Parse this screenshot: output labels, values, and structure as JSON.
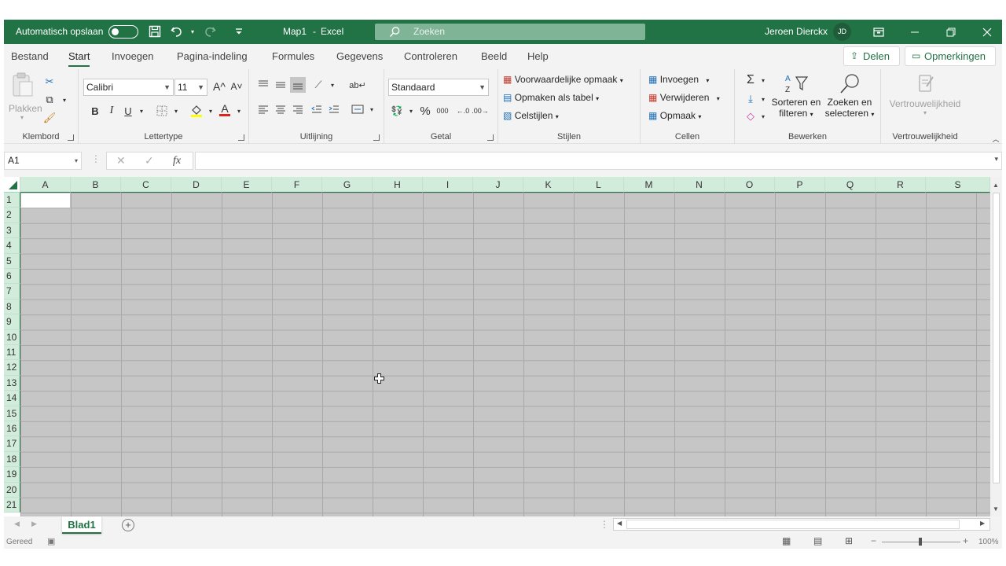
{
  "titlebar": {
    "autosave_label": "Automatisch opslaan",
    "doc_title": "Map1",
    "separator": "-",
    "app_name": "Excel",
    "search_placeholder": "Zoeken",
    "user_name": "Jeroen Dierckx",
    "user_initials": "JD",
    "accent_color": "#217346"
  },
  "tabs": [
    "Bestand",
    "Start",
    "Invoegen",
    "Pagina-indeling",
    "Formules",
    "Gegevens",
    "Controleren",
    "Beeld",
    "Help"
  ],
  "active_tab": "Start",
  "share_label": "Delen",
  "comments_label": "Opmerkingen",
  "ribbon": {
    "clipboard": {
      "label": "Klembord",
      "paste": "Plakken"
    },
    "font": {
      "label": "Lettertype",
      "name": "Calibri",
      "size": "11",
      "bold": "B",
      "italic": "I",
      "underline": "U",
      "grow": "A^",
      "shrink": "A˅",
      "color": "A"
    },
    "alignment": {
      "label": "Uitlijning"
    },
    "number": {
      "label": "Getal",
      "format": "Standaard",
      "percent": "%",
      "thousands": "000"
    },
    "styles": {
      "label": "Stijlen",
      "conditional": "Voorwaardelijke opmaak",
      "as_table": "Opmaken als tabel",
      "cell_styles": "Celstijlen"
    },
    "cells": {
      "label": "Cellen",
      "insert": "Invoegen",
      "delete": "Verwijderen",
      "format": "Opmaak"
    },
    "editing": {
      "label": "Bewerken",
      "sort1": "Sorteren en",
      "sort2": "filteren",
      "find1": "Zoeken en",
      "find2": "selecteren"
    },
    "sensitivity": {
      "label": "Vertrouwelijkheid",
      "button": "Vertrouwelijkheid"
    }
  },
  "formula_bar": {
    "name_box": "A1",
    "fx": "fx",
    "value": ""
  },
  "columns": [
    "A",
    "B",
    "C",
    "D",
    "E",
    "F",
    "G",
    "H",
    "I",
    "J",
    "K",
    "L",
    "M",
    "N",
    "O",
    "P",
    "Q",
    "R",
    "S"
  ],
  "rows": [
    "1",
    "2",
    "3",
    "4",
    "5",
    "6",
    "7",
    "8",
    "9",
    "10",
    "11",
    "12",
    "13",
    "14",
    "15",
    "16",
    "17",
    "18",
    "19",
    "20",
    "21"
  ],
  "sheet_tabs": [
    "Blad1"
  ],
  "status": {
    "ready": "Gereed",
    "zoom": "100%"
  }
}
